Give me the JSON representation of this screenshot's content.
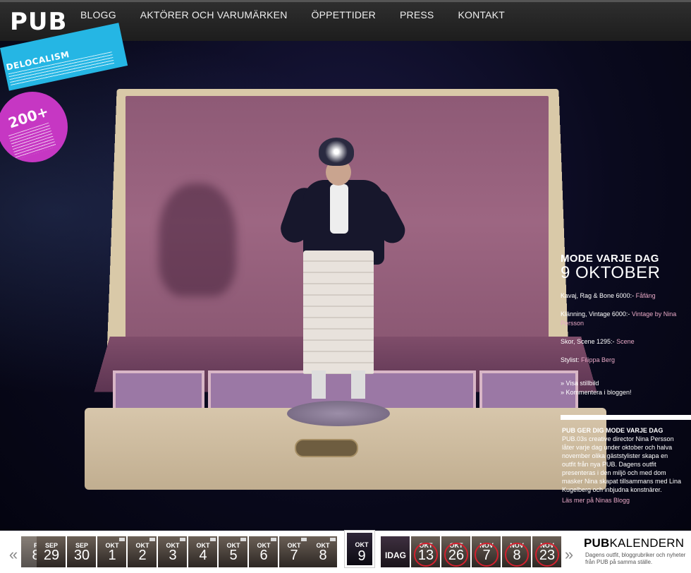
{
  "header": {
    "logo": "PUB",
    "nav": [
      "BLOGG",
      "AKTÖRER OCH VARUMÄRKEN",
      "ÖPPETTIDER",
      "PRESS",
      "KONTAKT"
    ]
  },
  "stickers": {
    "blue_title": "DELOCALISM",
    "pink_count": "200+"
  },
  "info": {
    "title": "MODE VARJE DAG",
    "date": "9 OKTOBER",
    "items": [
      {
        "text": "Kavaj, Rag & Bone 6000:- ",
        "src": "Fåfäng"
      },
      {
        "text": "Klänning, Vintage 6000:- ",
        "src": "Vintage by Nina Persson"
      },
      {
        "text": "Skor, Scene 1295:- ",
        "src": "Scene"
      },
      {
        "text": "Stylist: ",
        "src": "Filippa Berg"
      }
    ],
    "links": [
      "» Visa stillbild",
      "» Kommentera i bloggen!"
    ]
  },
  "promo": {
    "head": "PUB GER DIG MODE VARJE DAG",
    "body": "PUB.03s creative director Nina Persson låter varje dag under oktober och halva november olika gäststylister skapa en outfit från nya PUB. Dagens outfit presenteras i den miljö och med dom masker Nina skapat tillsammans med Lina Kugelberg och inbjudna konstnärer.",
    "link": "Läs mer på Ninas Blogg"
  },
  "calendar": {
    "brand_bold": "PUB",
    "brand_rest": "KALENDERN",
    "desc": "Dagens outfit, bloggrubriker och nyheter från PUB på samma ställe.",
    "prev_arrow": "«",
    "next_arrow": "»",
    "days": [
      {
        "m": "P",
        "d": "8"
      },
      {
        "m": "SEP",
        "d": "29"
      },
      {
        "m": "SEP",
        "d": "30"
      },
      {
        "m": "OKT",
        "d": "1"
      },
      {
        "m": "OKT",
        "d": "2"
      },
      {
        "m": "OKT",
        "d": "3"
      },
      {
        "m": "OKT",
        "d": "4"
      },
      {
        "m": "OKT",
        "d": "5"
      },
      {
        "m": "OKT",
        "d": "6"
      },
      {
        "m": "OKT",
        "d": "7"
      },
      {
        "m": "OKT",
        "d": "8"
      },
      {
        "m": "OKT",
        "d": "9"
      },
      {
        "m": "IDAG",
        "d": ""
      },
      {
        "m": "OKT",
        "d": "13"
      },
      {
        "m": "OKT",
        "d": "26"
      },
      {
        "m": "NOV",
        "d": "7"
      },
      {
        "m": "NOV",
        "d": "8"
      },
      {
        "m": "NOV",
        "d": "23"
      }
    ]
  }
}
